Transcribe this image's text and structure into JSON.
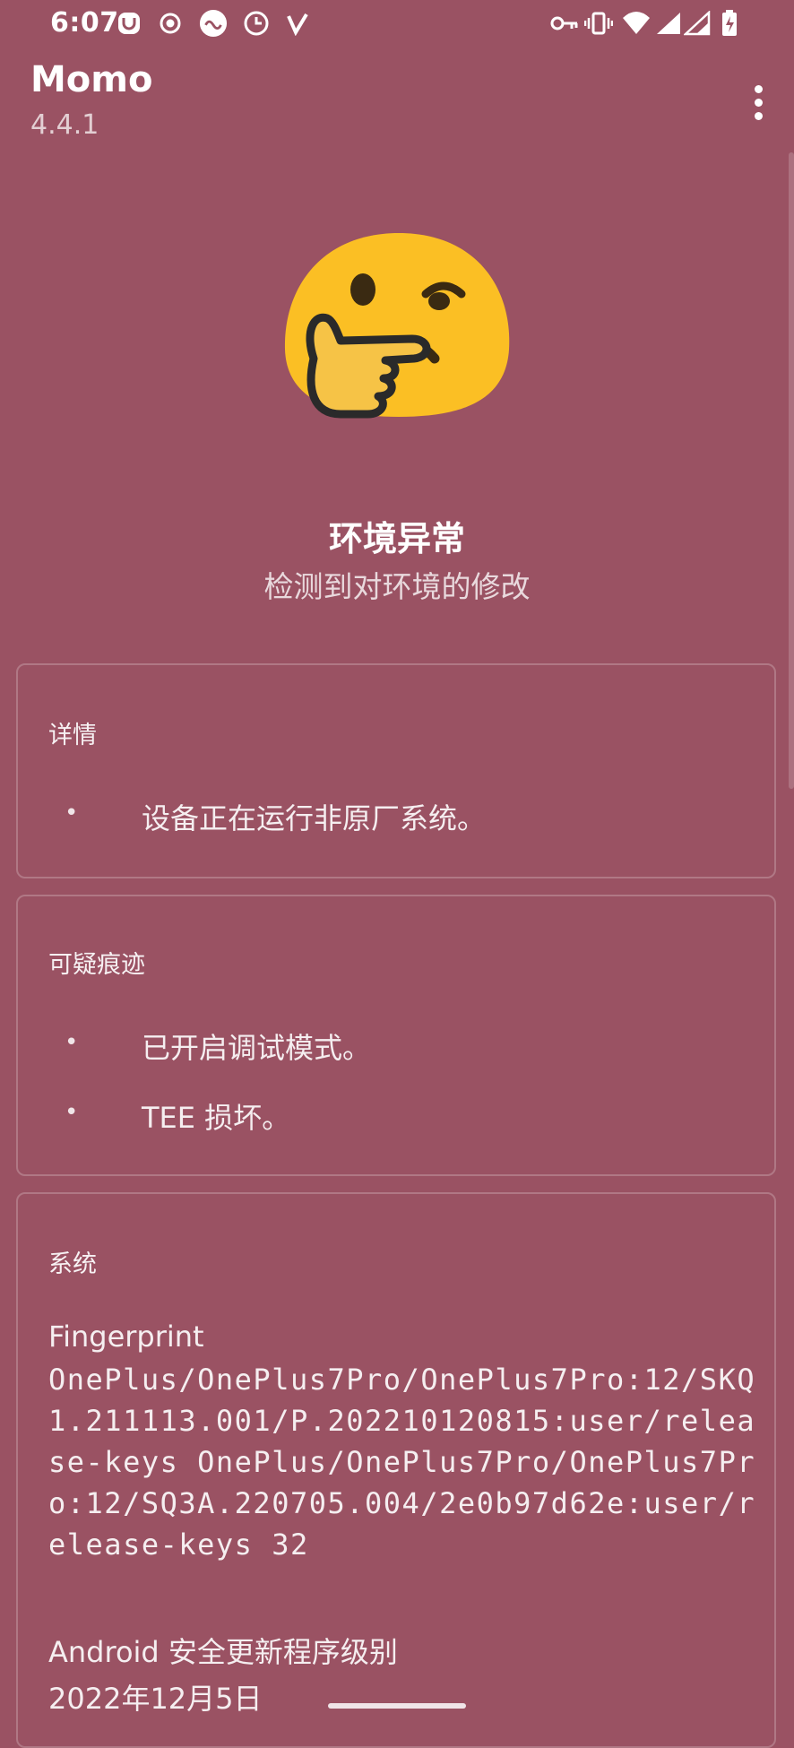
{
  "status_bar": {
    "time": "6:07",
    "left_icons": [
      "face-app-icon",
      "record-icon",
      "loop-icon",
      "clock-icon",
      "v-icon"
    ],
    "right_icons": [
      "key-icon",
      "vibrate-icon",
      "wifi-icon",
      "signal-icon",
      "signal-icon-2",
      "battery-charging-icon"
    ]
  },
  "app_bar": {
    "title": "Momo",
    "version": "4.4.1",
    "menu_icon": "more-vert-icon"
  },
  "hero": {
    "emoji_icon": "thinking-face-icon",
    "title": "环境异常",
    "subtitle": "检测到对环境的修改"
  },
  "details_card": {
    "title": "详情",
    "items": [
      "设备正在运行非原厂系统。"
    ]
  },
  "suspicious_card": {
    "title": "可疑痕迹",
    "items": [
      "已开启调试模式。",
      "TEE 损坏。"
    ]
  },
  "system_card": {
    "title": "系统",
    "fingerprint_label": "Fingerprint",
    "fingerprint_value": "OnePlus/OnePlus7Pro/OnePlus7Pro:12/SKQ1.211113.001/P.202210120815:user/release-keys OnePlus/OnePlus7Pro/OnePlus7Pro:12/SQ3A.220705.004/2e0b97d62e:user/release-keys 32",
    "security_patch_label": "Android 安全更新程序级别",
    "security_patch_value": "2022年12月5日"
  },
  "colors": {
    "background": "#9a5263",
    "emoji_yellow": "#fbbf24"
  }
}
